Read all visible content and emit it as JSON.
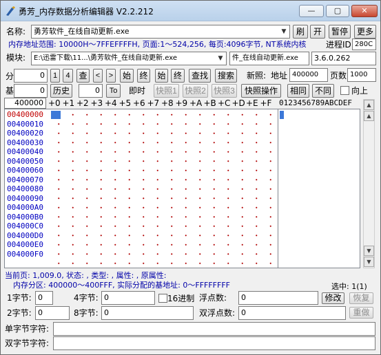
{
  "window": {
    "title": "勇芳_内存数据分析编辑器 V2.2.212",
    "controls": [
      "—",
      "▢",
      "✕"
    ]
  },
  "row1": {
    "name_label": "名称:",
    "name_value": "勇芳软件_在线自动更新.exe",
    "refresh": "刷",
    "open": "开",
    "pause": "暂停",
    "more": "更多"
  },
  "row2": {
    "range_text": "内存地址范围: 10000H～7FFEFFFFH, 页面:1～524,256, 每页:4096字节, NT系统内核",
    "pid_label": "进程ID",
    "pid_value": "280C"
  },
  "row3": {
    "module_label": "模块:",
    "module_value": "E:\\迅雷下载\\11...\\勇芳软件_在线自动更新.exe",
    "module_name": "件_在线自动更新.exe",
    "version": "3.6.0.262"
  },
  "row4": {
    "fen_label": "分",
    "fen_value": "0",
    "b1": "1",
    "b4": "4",
    "query": "查",
    "prev": "<",
    "next": ">",
    "start1": "始",
    "end1": "终",
    "start2": "始",
    "end2": "终",
    "find": "查找",
    "search": "搜索",
    "new_label": "新照:",
    "addr_label": "地址",
    "addr_value": "400000",
    "pagebytes_label": "页数",
    "pagebytes_value": "1000"
  },
  "row5": {
    "base_label": "基",
    "base_value": "0",
    "history": "历史",
    "to_value": "0",
    "to": "To",
    "instant": "即时",
    "snap1": "快照1",
    "snap2": "快照2",
    "snap3": "快照3",
    "snap_ops": "快照操作",
    "same": "相同",
    "diff": "不同",
    "up_label": "向上"
  },
  "hex": {
    "base_addr": "400000",
    "columns": [
      "+0",
      "+1",
      "+2",
      "+3",
      "+4",
      "+5",
      "+6",
      "+7",
      "+8",
      "+9",
      "+A",
      "+B",
      "+C",
      "+D",
      "+E",
      "+F"
    ],
    "ascii_header": "0123456789ABCDEF",
    "rows": [
      "00400000",
      "00400010",
      "00400020",
      "00400030",
      "00400040",
      "00400050",
      "00400060",
      "00400070",
      "00400080",
      "00400090",
      "004000A0",
      "004000B0",
      "004000C0",
      "004000D0",
      "004000E0",
      "004000F0"
    ]
  },
  "status": {
    "line1": "当前页: 1,009.0, 状态: , 类型: , 属性: , 原属性:",
    "line2": "内存分区: 400000～400FFF, 实际分配的基地址: 0～FFFFFFFF",
    "selected": "选中: 1(1)"
  },
  "values": {
    "byte1_label": "1字节:",
    "byte1": "0",
    "byte4_label": "4字节:",
    "byte4": "0",
    "hex16_label": "16进制",
    "float_label": "浮点数:",
    "float": "0",
    "modify": "修改",
    "restore": "恢复",
    "byte2_label": "2字节:",
    "byte2": "0",
    "byte8_label": "8字节:",
    "byte8": "0",
    "double_label": "双浮点数:",
    "double": "0",
    "redo": "重做",
    "sbstr_label": "单字节字符:",
    "sbstr": "",
    "dbstr_label": "双字节字符:",
    "dbstr": ""
  }
}
